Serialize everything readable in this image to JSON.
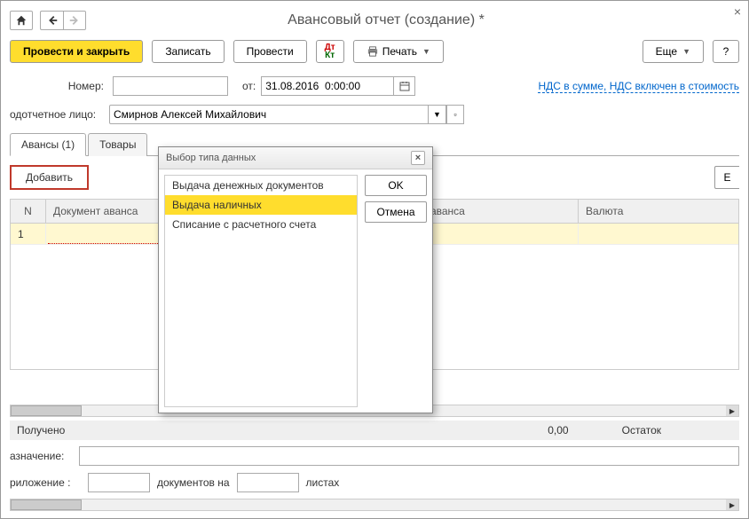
{
  "header": {
    "title": "Авансовый отчет (создание) *"
  },
  "toolbar": {
    "submit_close": "Провести и закрыть",
    "save": "Записать",
    "submit": "Провести",
    "print": "Печать",
    "more": "Еще",
    "help": "?"
  },
  "form": {
    "number_label": "Номер:",
    "number_value": "",
    "from_label": "от:",
    "date_value": "31.08.2016  0:00:00",
    "vat_link": "НДС в сумме, НДС включен в стоимость",
    "person_label": "одотчетное лицо:",
    "person_value": "Смирнов Алексей Михайлович"
  },
  "tabs": {
    "advances": "Авансы (1)",
    "goods": "Товары"
  },
  "tab_actions": {
    "add": "Добавить",
    "more_short": "Е"
  },
  "table": {
    "headers": {
      "n": "N",
      "doc": "Документ аванса",
      "sum": "има аванса",
      "currency": "Валюта"
    },
    "rows": [
      {
        "n": "1",
        "doc": "",
        "sum": "",
        "currency": ""
      }
    ]
  },
  "footer": {
    "received_label": "Получено",
    "received_value": "0,00",
    "remainder_label": "Остаток",
    "purpose_label": "азначение:",
    "attachment_label": "риложение :",
    "docs_on": "документов на",
    "sheets": "листах"
  },
  "modal": {
    "title": "Выбор типа данных",
    "items": [
      "Выдача денежных документов",
      "Выдача наличных",
      "Списание с расчетного счета"
    ],
    "selected_index": 1,
    "ok": "OK",
    "cancel": "Отмена"
  }
}
